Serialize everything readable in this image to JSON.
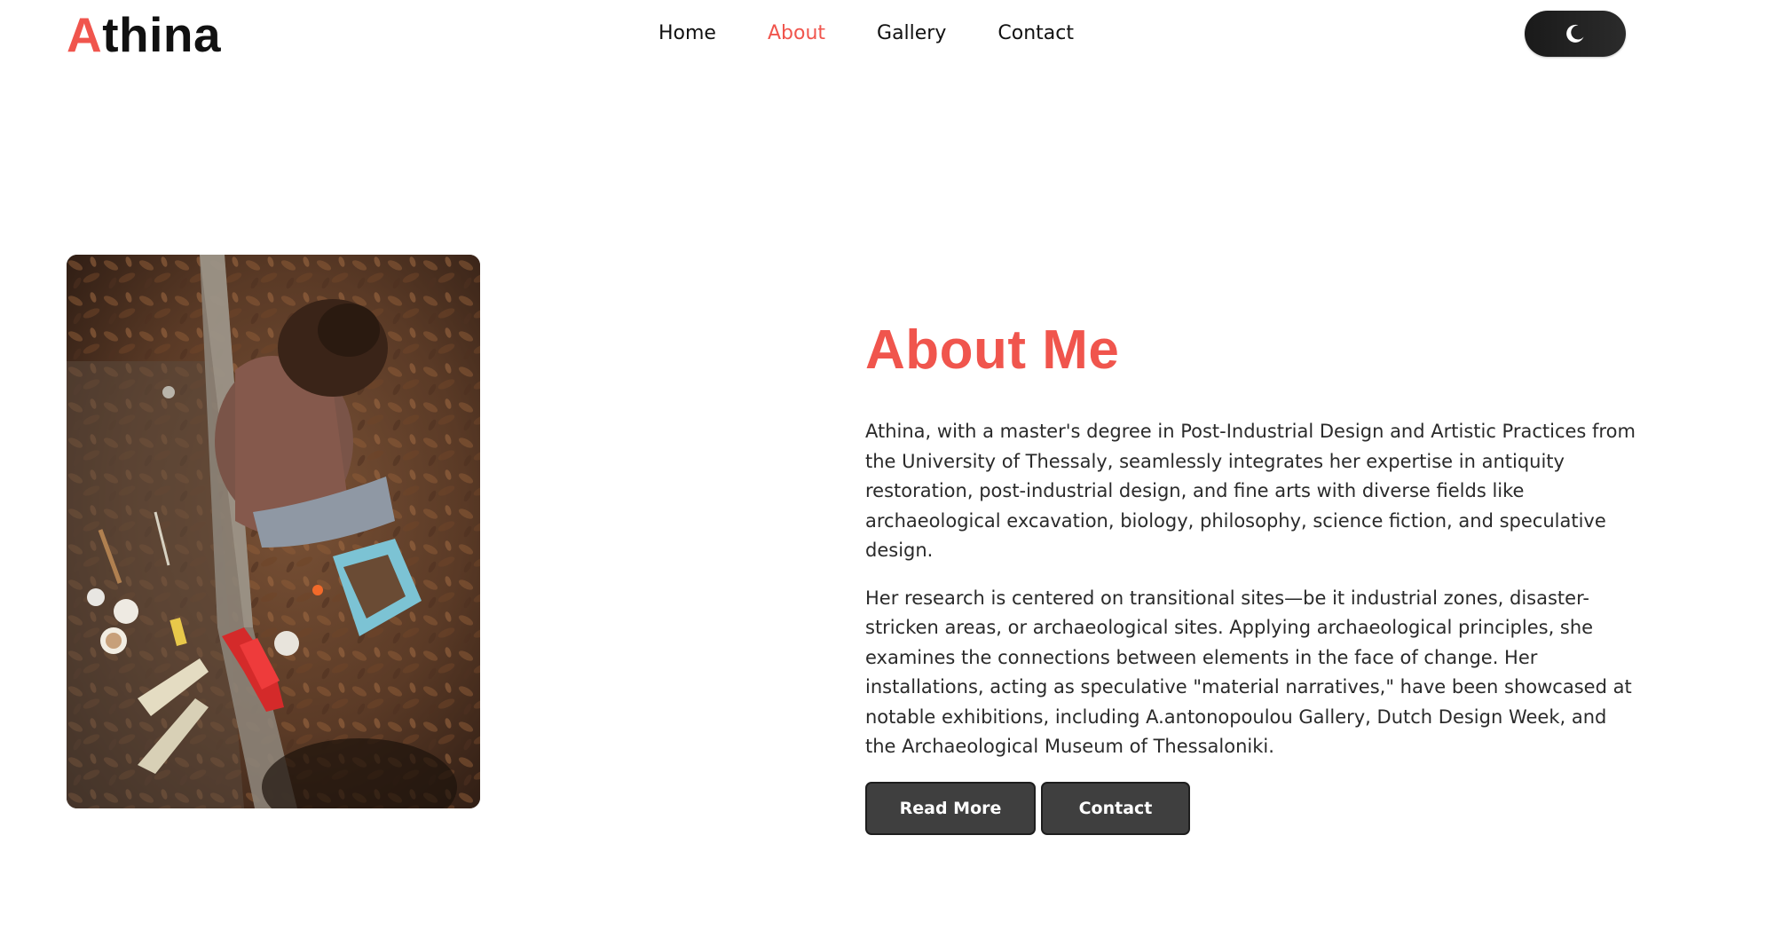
{
  "header": {
    "logo_initial": "A",
    "logo_rest": "thina",
    "nav": [
      {
        "label": "Home",
        "active": false
      },
      {
        "label": "About",
        "active": true
      },
      {
        "label": "Gallery",
        "active": false
      },
      {
        "label": "Contact",
        "active": false
      }
    ],
    "theme_toggle_icon": "moon-icon"
  },
  "about": {
    "heading": "About Me",
    "paragraph1": "Athina, with a master's degree in Post-Industrial Design and Artistic Practices from the University of Thessaly, seamlessly integrates her expertise in antiquity restoration, post-industrial design, and fine arts with diverse fields like archaeological excavation, biology, philosophy, science fiction, and speculative design.",
    "paragraph2": "Her research is centered on transitional sites—be it industrial zones, disaster-stricken areas, or archaeological sites. Applying archaeological principles, she examines the connections between elements in the face of change. Her installations, acting as speculative \"material narratives,\" have been showcased at notable exhibitions, including A.antonopoulou Gallery, Dutch Design Week, and the Archaeological Museum of Thessaloniki.",
    "read_more_label": "Read More",
    "contact_label": "Contact"
  },
  "colors": {
    "accent": "#f0554d",
    "button_bg": "#3f3f3f",
    "toggle_bg": "#1f1f1f"
  }
}
